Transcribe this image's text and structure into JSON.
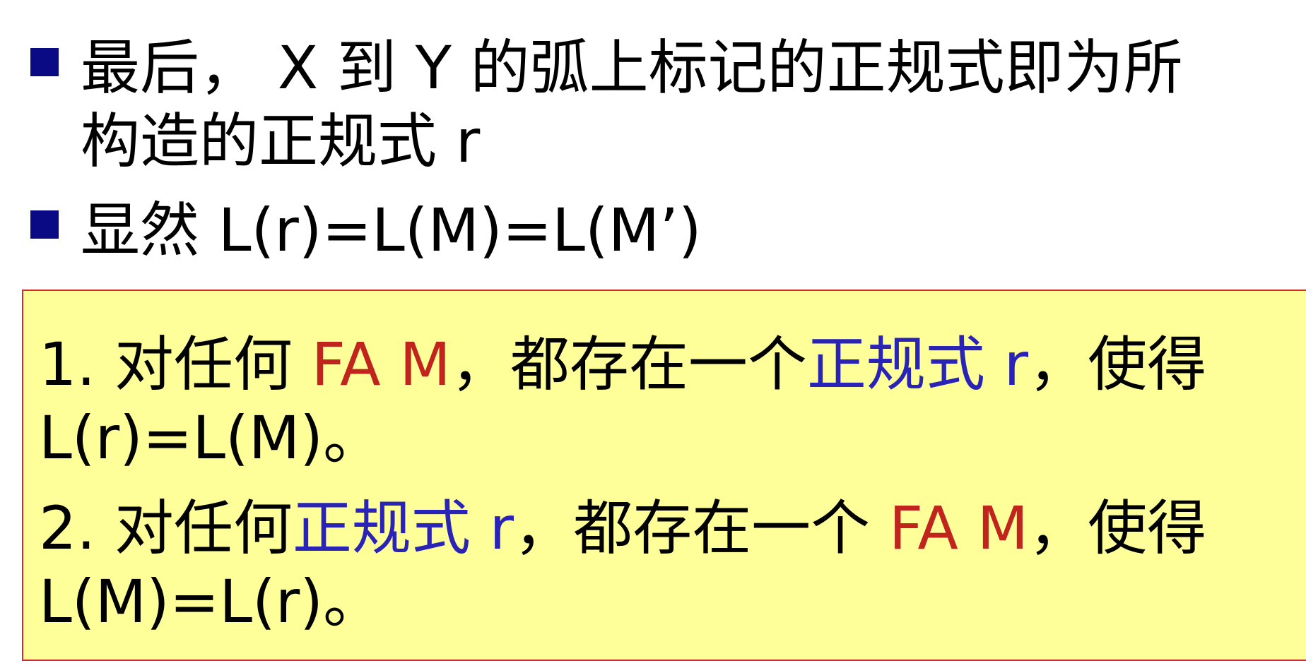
{
  "bullets": [
    {
      "line1": "最后， X 到 Y 的弧上标记的正规式即为所",
      "line2": "构造的正规式 r"
    },
    {
      "line1": "显然 L(r)=L(M)=L(M’)"
    }
  ],
  "callout": {
    "theorem1": {
      "prefix": "1. 对任何 ",
      "fa": "FA M",
      "mid": "，都存在一个",
      "regex": "正规式 r",
      "suffix": "，使得",
      "line2": "L(r)=L(M)。"
    },
    "theorem2": {
      "prefix": "2. 对任何",
      "regex": "正规式 r",
      "mid": "，都存在一个 ",
      "fa": "FA M",
      "suffix": "，使得",
      "line2": "L(M)=L(r)。"
    }
  },
  "colors": {
    "bullet_marker": "#0a0a84",
    "callout_background": "#ffff99",
    "callout_border": "#d62b2b",
    "fa_text": "#c0241c",
    "regex_text": "#2a23b8"
  }
}
